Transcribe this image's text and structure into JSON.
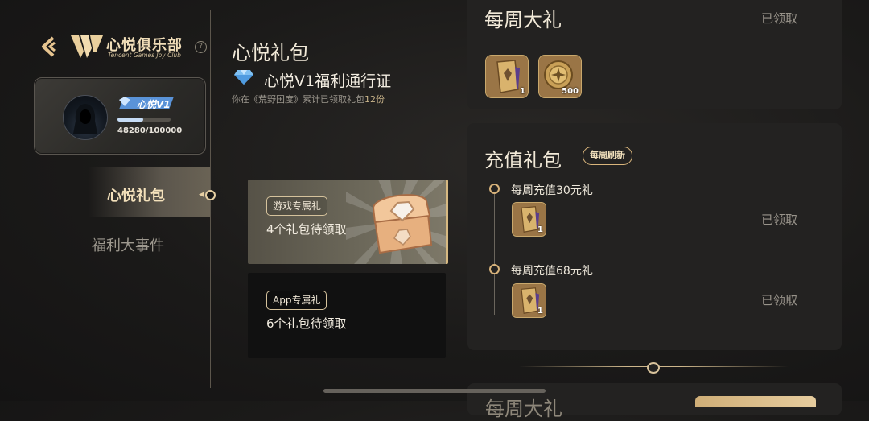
{
  "sidebar": {
    "back_icon": "back-arrow-icon",
    "logo_title": "心悦俱乐部",
    "logo_subtitle": "Tencent Games Joy Club",
    "help_icon": "help-icon",
    "profile": {
      "vip_label": "心悦V1",
      "progress_text": "48280/100000",
      "progress_fraction": 0.4828
    },
    "nav": [
      {
        "label": "心悦礼包",
        "active": true
      },
      {
        "label": "福利大事件",
        "active": false
      }
    ]
  },
  "main": {
    "title": "心悦礼包",
    "pass_title": "心悦V1福利通行证",
    "pass_desc_prefix": "你在《荒野国度》累计已领取礼包",
    "pass_desc_count": "12份",
    "cards": [
      {
        "tag": "游戏专属礼",
        "count": "4个礼包待领取"
      },
      {
        "tag": "App专属礼",
        "count": "6个礼包待领取"
      }
    ]
  },
  "right": {
    "weekly": {
      "title": "每周大礼",
      "status": "已领取",
      "items": [
        {
          "icon": "gold-card-icon",
          "qty": "1"
        },
        {
          "icon": "gold-coin-icon",
          "qty": "500"
        }
      ]
    },
    "recharge": {
      "title": "充值礼包",
      "badge": "每周刷新",
      "tiers": [
        {
          "label": "每周充值30元礼",
          "status": "已领取",
          "item_icon": "gold-card-icon",
          "qty": "1"
        },
        {
          "label": "每周充值68元礼",
          "status": "已领取",
          "item_icon": "gold-card-icon",
          "qty": "1"
        }
      ]
    },
    "next_panel_title": "每周大礼"
  },
  "colors": {
    "accent_gold": "#d7b982",
    "background": "#1b1a19",
    "panel": "#232221"
  }
}
